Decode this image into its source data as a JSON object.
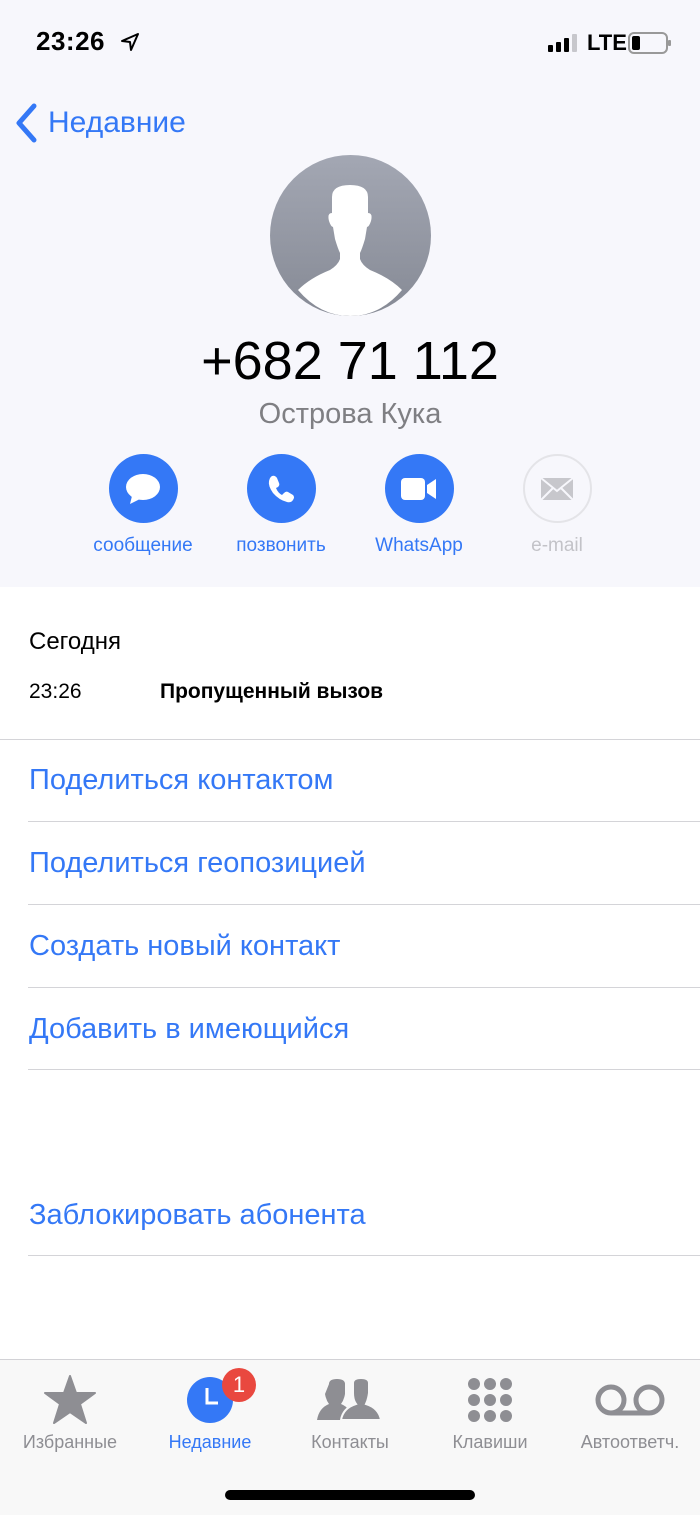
{
  "status_bar": {
    "time": "23:26",
    "network": "LTE",
    "icons": [
      "location-arrow-icon",
      "cellular-signal-icon",
      "battery-icon"
    ]
  },
  "nav": {
    "back_label": "Недавние",
    "back_icon": "chevron-left-icon"
  },
  "contact": {
    "avatar_icon": "person-silhouette-icon",
    "phone_number": "+682 71 112",
    "location": "Острова Кука"
  },
  "actions": [
    {
      "label": "сообщение",
      "icon": "message-bubble-icon",
      "enabled": true
    },
    {
      "label": "позвонить",
      "icon": "phone-icon",
      "enabled": true
    },
    {
      "label": "WhatsApp",
      "icon": "video-camera-icon",
      "enabled": true
    },
    {
      "label": "e-mail",
      "icon": "envelope-icon",
      "enabled": false
    }
  ],
  "history": {
    "section_title": "Сегодня",
    "entries": [
      {
        "time": "23:26",
        "type": "Пропущенный вызов"
      }
    ]
  },
  "options": [
    "Поделиться контактом",
    "Поделиться геопозицией",
    "Создать новый контакт",
    "Добавить в имеющийся"
  ],
  "block_label": "Заблокировать абонента",
  "tabbar": {
    "active": "Недавние",
    "accent_color": "#3478f6",
    "badge_color": "#e9483f",
    "tabs": [
      {
        "label": "Избранные",
        "icon": "star-icon"
      },
      {
        "label": "Недавние",
        "icon": "clock-icon",
        "badge": "1"
      },
      {
        "label": "Контакты",
        "icon": "contacts-icon"
      },
      {
        "label": "Клавиши",
        "icon": "keypad-icon"
      },
      {
        "label": "Автоответч.",
        "icon": "voicemail-icon"
      }
    ]
  }
}
